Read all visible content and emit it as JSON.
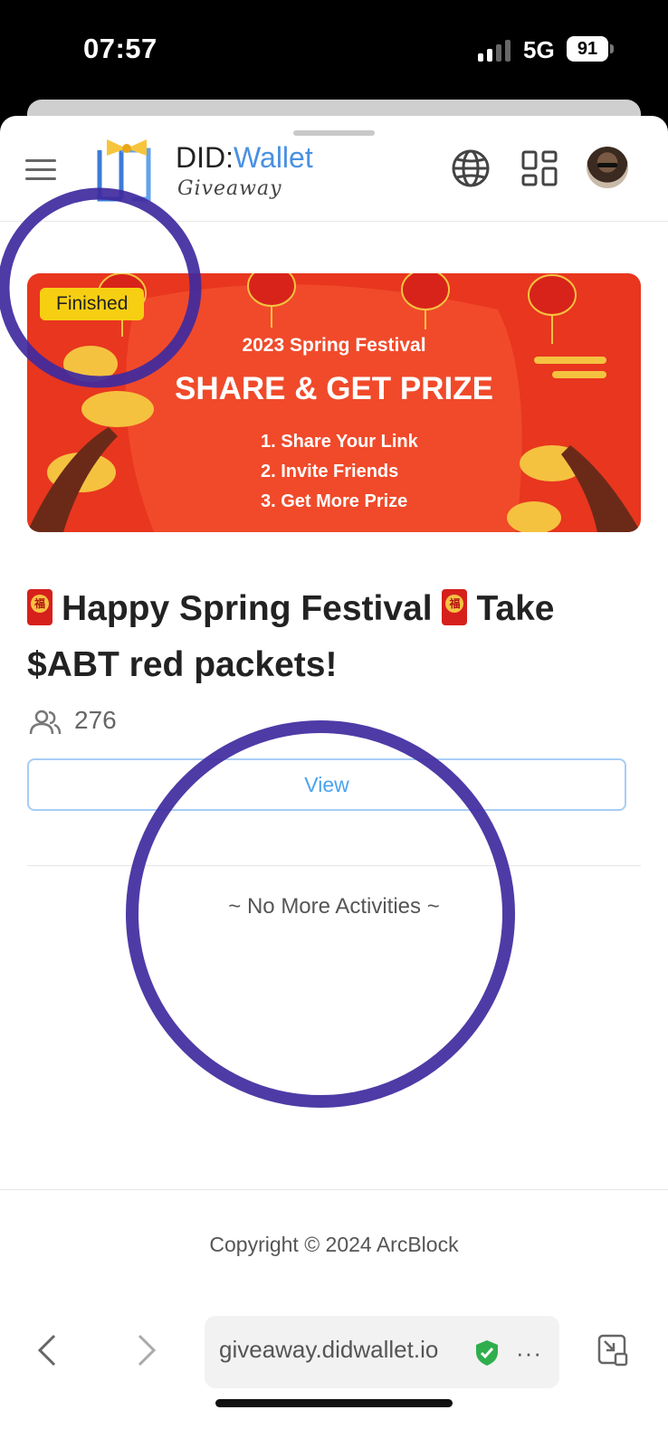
{
  "status_bar": {
    "time": "07:57",
    "network": "5G",
    "battery": "91"
  },
  "header": {
    "logo_did": "DID:",
    "logo_wallet": "Wallet",
    "logo_subtitle": "Giveaway"
  },
  "banner": {
    "badge": "Finished",
    "subtitle": "2023 Spring Festival",
    "title": "SHARE & GET PRIZE",
    "steps": [
      "1. Share Your Link",
      "2. Invite Friends",
      "3. Get More Prize"
    ]
  },
  "activity": {
    "title_part1": "Happy Spring Festival",
    "title_part2": "Take $ABT red packets!",
    "participants": "276",
    "view_label": "View"
  },
  "list_end": "~ No More Activities ~",
  "footer": {
    "copyright": "Copyright © 2024 ArcBlock"
  },
  "browser": {
    "url": "giveaway.didwallet.io",
    "more": "···"
  },
  "colors": {
    "accent": "#4a90e2",
    "banner_red": "#e8361f",
    "badge_yellow": "#f7cf12",
    "annotation": "#3f2a9e"
  }
}
